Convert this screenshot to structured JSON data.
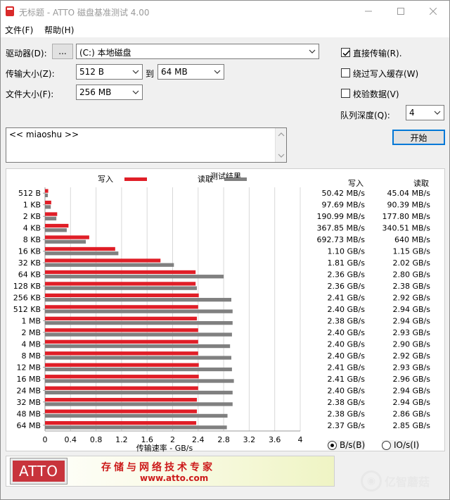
{
  "window": {
    "title": "无标题 - ATTO 磁盘基准测试 4.00"
  },
  "menu": {
    "file": "文件(F)",
    "help": "帮助(H)"
  },
  "controls": {
    "drive_label": "驱动器(D):",
    "browse_label": "...",
    "drive_value": "(C:) 本地磁盘",
    "transfer_label": "传输大小(Z):",
    "transfer_from": "512 B",
    "to_label": "到",
    "transfer_to": "64 MB",
    "file_size_label": "文件大小(F):",
    "file_size": "256 MB",
    "direct_io": {
      "label": "直接传输(R).",
      "checked": true
    },
    "bypass_cache": {
      "label": "绕过写入缓存(W)",
      "checked": false
    },
    "verify": {
      "label": "校验数据(V)",
      "checked": false
    },
    "queue_label": "队列深度(Q):",
    "queue_value": "4",
    "start_label": "开始"
  },
  "notes": "<< miaoshu >>",
  "chart_data": {
    "type": "bar",
    "title": "测试结果",
    "xlabel": "传输速率 - GB/s",
    "xlim": [
      0,
      4
    ],
    "x_ticks": [
      "0",
      "0.4",
      "0.8",
      "1.2",
      "1.6",
      "2",
      "2.4",
      "2.8",
      "3.2",
      "3.6",
      "4"
    ],
    "categories": [
      "512 B",
      "1 KB",
      "2 KB",
      "4 KB",
      "8 KB",
      "16 KB",
      "32 KB",
      "64 KB",
      "128 KB",
      "256 KB",
      "512 KB",
      "1 MB",
      "2 MB",
      "4 MB",
      "8 MB",
      "12 MB",
      "16 MB",
      "24 MB",
      "32 MB",
      "48 MB",
      "64 MB"
    ],
    "series": [
      {
        "name": "写入",
        "color": "#e01e27",
        "values": [
          0.0504,
          0.0977,
          0.191,
          0.368,
          0.693,
          1.1,
          1.81,
          2.36,
          2.36,
          2.41,
          2.4,
          2.38,
          2.4,
          2.4,
          2.4,
          2.41,
          2.41,
          2.4,
          2.38,
          2.38,
          2.37
        ]
      },
      {
        "name": "读取",
        "color": "#808080",
        "values": [
          0.045,
          0.0904,
          0.178,
          0.341,
          0.64,
          1.15,
          2.02,
          2.8,
          2.38,
          2.92,
          2.94,
          2.94,
          2.93,
          2.9,
          2.92,
          2.93,
          2.96,
          2.94,
          2.94,
          2.86,
          2.85
        ]
      }
    ],
    "table": {
      "write_header": "写入",
      "read_header": "读取",
      "write": [
        "50.42 MB/s",
        "97.69 MB/s",
        "190.99 MB/s",
        "367.85 MB/s",
        "692.73 MB/s",
        "1.10 GB/s",
        "1.81 GB/s",
        "2.36 GB/s",
        "2.36 GB/s",
        "2.41 GB/s",
        "2.40 GB/s",
        "2.38 GB/s",
        "2.40 GB/s",
        "2.40 GB/s",
        "2.40 GB/s",
        "2.41 GB/s",
        "2.41 GB/s",
        "2.40 GB/s",
        "2.38 GB/s",
        "2.38 GB/s",
        "2.37 GB/s"
      ],
      "read": [
        "45.04 MB/s",
        "90.39 MB/s",
        "177.80 MB/s",
        "340.51 MB/s",
        "640 MB/s",
        "1.15 GB/s",
        "2.02 GB/s",
        "2.80 GB/s",
        "2.38 GB/s",
        "2.92 GB/s",
        "2.94 GB/s",
        "2.94 GB/s",
        "2.93 GB/s",
        "2.90 GB/s",
        "2.92 GB/s",
        "2.93 GB/s",
        "2.96 GB/s",
        "2.94 GB/s",
        "2.94 GB/s",
        "2.86 GB/s",
        "2.85 GB/s"
      ]
    }
  },
  "units": {
    "bs_label": "B/s(B)",
    "bs_selected": true,
    "ios_label": "IO/s(I)",
    "ios_selected": false
  },
  "banner": {
    "logo": "ATTO",
    "slogan": "存储与网络技术专家",
    "url": "www.atto.com"
  },
  "watermark": {
    "text": "亿智蘑菇"
  }
}
